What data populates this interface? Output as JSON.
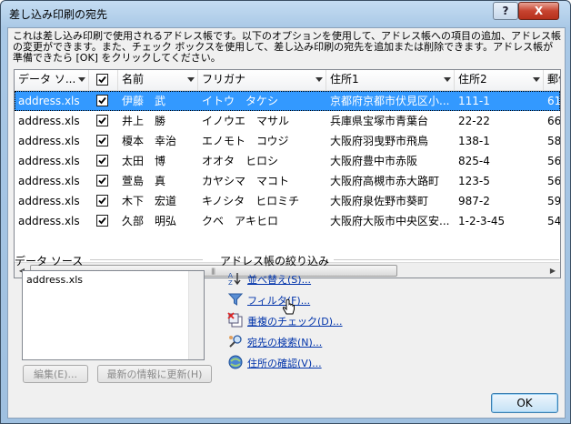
{
  "window": {
    "title": "差し込み印刷の宛先",
    "help_label": "?",
    "close_label": "X"
  },
  "description": "これは差し込み印刷で使用されるアドレス帳です。以下のオプションを使用して、アドレス帳への項目の追加、アドレス帳の変更ができます。また、チェック ボックスを使用して、差し込み印刷の宛先を追加または削除できます。アドレス帳が準備できたら [OK] をクリックしてください。",
  "table": {
    "columns": [
      "データ ソ...",
      "",
      "名前",
      "フリガナ",
      "住所1",
      "住所2",
      "郵便"
    ],
    "rows": [
      {
        "source": "address.xls",
        "checked": true,
        "name": "伊藤　武",
        "kana": "イトウ　タケシ",
        "addr1": "京都府京都市伏見区小...",
        "addr2": "111-1",
        "zip": "61"
      },
      {
        "source": "address.xls",
        "checked": true,
        "name": "井上　勝",
        "kana": "イノウエ　マサル",
        "addr1": "兵庫県宝塚市青葉台",
        "addr2": "22-22",
        "zip": "66"
      },
      {
        "source": "address.xls",
        "checked": true,
        "name": "榎本　幸治",
        "kana": "エノモト　コウジ",
        "addr1": "大阪府羽曳野市飛鳥",
        "addr2": "138-1",
        "zip": "58"
      },
      {
        "source": "address.xls",
        "checked": true,
        "name": "太田　博",
        "kana": "オオタ　ヒロシ",
        "addr1": "大阪府豊中市赤阪",
        "addr2": "825-4",
        "zip": "56"
      },
      {
        "source": "address.xls",
        "checked": true,
        "name": "萱島　真",
        "kana": "カヤシマ　マコト",
        "addr1": "大阪府高槻市赤大路町",
        "addr2": "123-5",
        "zip": "56"
      },
      {
        "source": "address.xls",
        "checked": true,
        "name": "木下　宏道",
        "kana": "キノシタ　ヒロミチ",
        "addr1": "大阪府泉佐野市葵町",
        "addr2": "987-2",
        "zip": "59"
      },
      {
        "source": "address.xls",
        "checked": true,
        "name": "久部　明弘",
        "kana": "クベ　アキヒロ",
        "addr1": "大阪府大阪市中央区安...",
        "addr2": "1-2-3-45",
        "zip": "54"
      }
    ],
    "selected_row": 0
  },
  "datasource": {
    "label": "データ ソース",
    "items": [
      "address.xls"
    ],
    "edit_button": "編集(E)...",
    "refresh_button": "最新の情報に更新(H)"
  },
  "refine": {
    "label": "アドレス帳の絞り込み",
    "links": [
      "並べ替え(S)...",
      "フィルタ(F)...",
      "重複のチェック(D)...",
      "宛先の検索(N)...",
      "住所の確認(V)..."
    ]
  },
  "ok_button": "OK"
}
